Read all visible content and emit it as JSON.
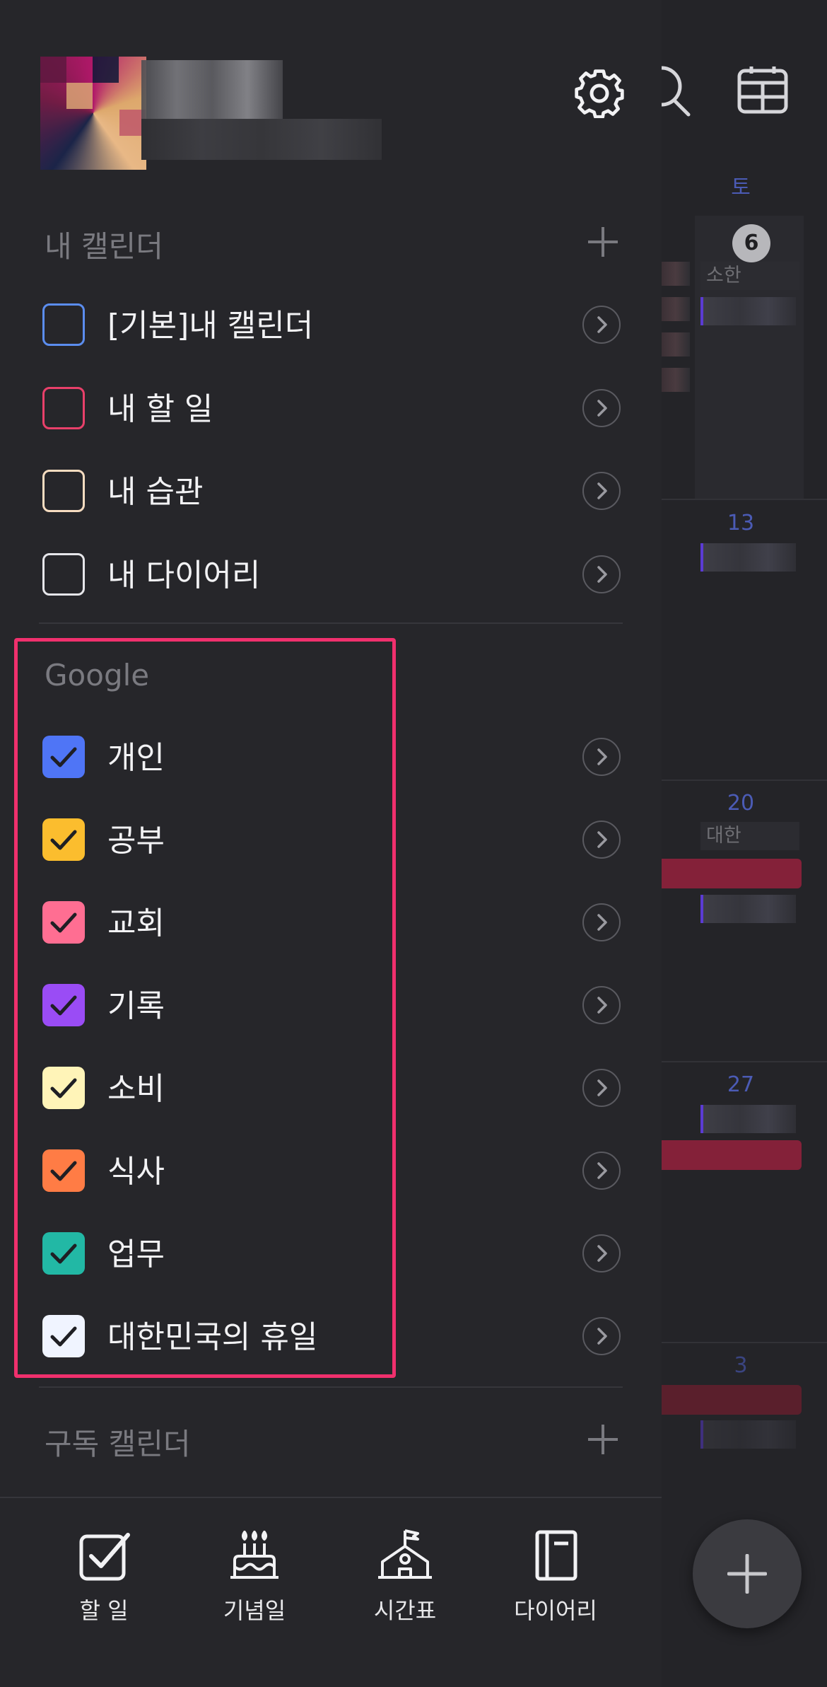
{
  "background_calendar": {
    "weekday_label": "토",
    "day_numbers": [
      "6",
      "13",
      "20",
      "27",
      "3"
    ],
    "holiday_labels": [
      "소한",
      "대한"
    ]
  },
  "drawer": {
    "my_calendars": {
      "title": "내 캘린더",
      "items": [
        {
          "label": "[기본]내 캘린더",
          "color": "#5b8def",
          "checked": false
        },
        {
          "label": "내 할 일",
          "color": "#e8406a",
          "checked": false
        },
        {
          "label": "내 습관",
          "color": "#f6dcc0",
          "checked": false
        },
        {
          "label": "내 다이어리",
          "color": "#e6e6ea",
          "checked": false
        }
      ]
    },
    "google": {
      "title": "Google",
      "items": [
        {
          "label": "개인",
          "color": "#4f75f6",
          "checked": true
        },
        {
          "label": "공부",
          "color": "#fbbd2e",
          "checked": true
        },
        {
          "label": "교회",
          "color": "#ff6e92",
          "checked": true
        },
        {
          "label": "기록",
          "color": "#9a4cf5",
          "checked": true
        },
        {
          "label": "소비",
          "color": "#fff4b8",
          "checked": true
        },
        {
          "label": "식사",
          "color": "#ff7c45",
          "checked": true
        },
        {
          "label": "업무",
          "color": "#22b8a5",
          "checked": true
        },
        {
          "label": "대한민국의 휴일",
          "color": "#f0f4ff",
          "checked": true
        }
      ]
    },
    "subscribed": {
      "title": "구독 캘린더"
    },
    "highlight_color": "#f0306d"
  },
  "bottom_tabs": [
    {
      "label": "할 일",
      "icon": "checkbox-icon"
    },
    {
      "label": "기념일",
      "icon": "cake-icon"
    },
    {
      "label": "시간표",
      "icon": "school-icon"
    },
    {
      "label": "다이어리",
      "icon": "notebook-icon"
    }
  ]
}
